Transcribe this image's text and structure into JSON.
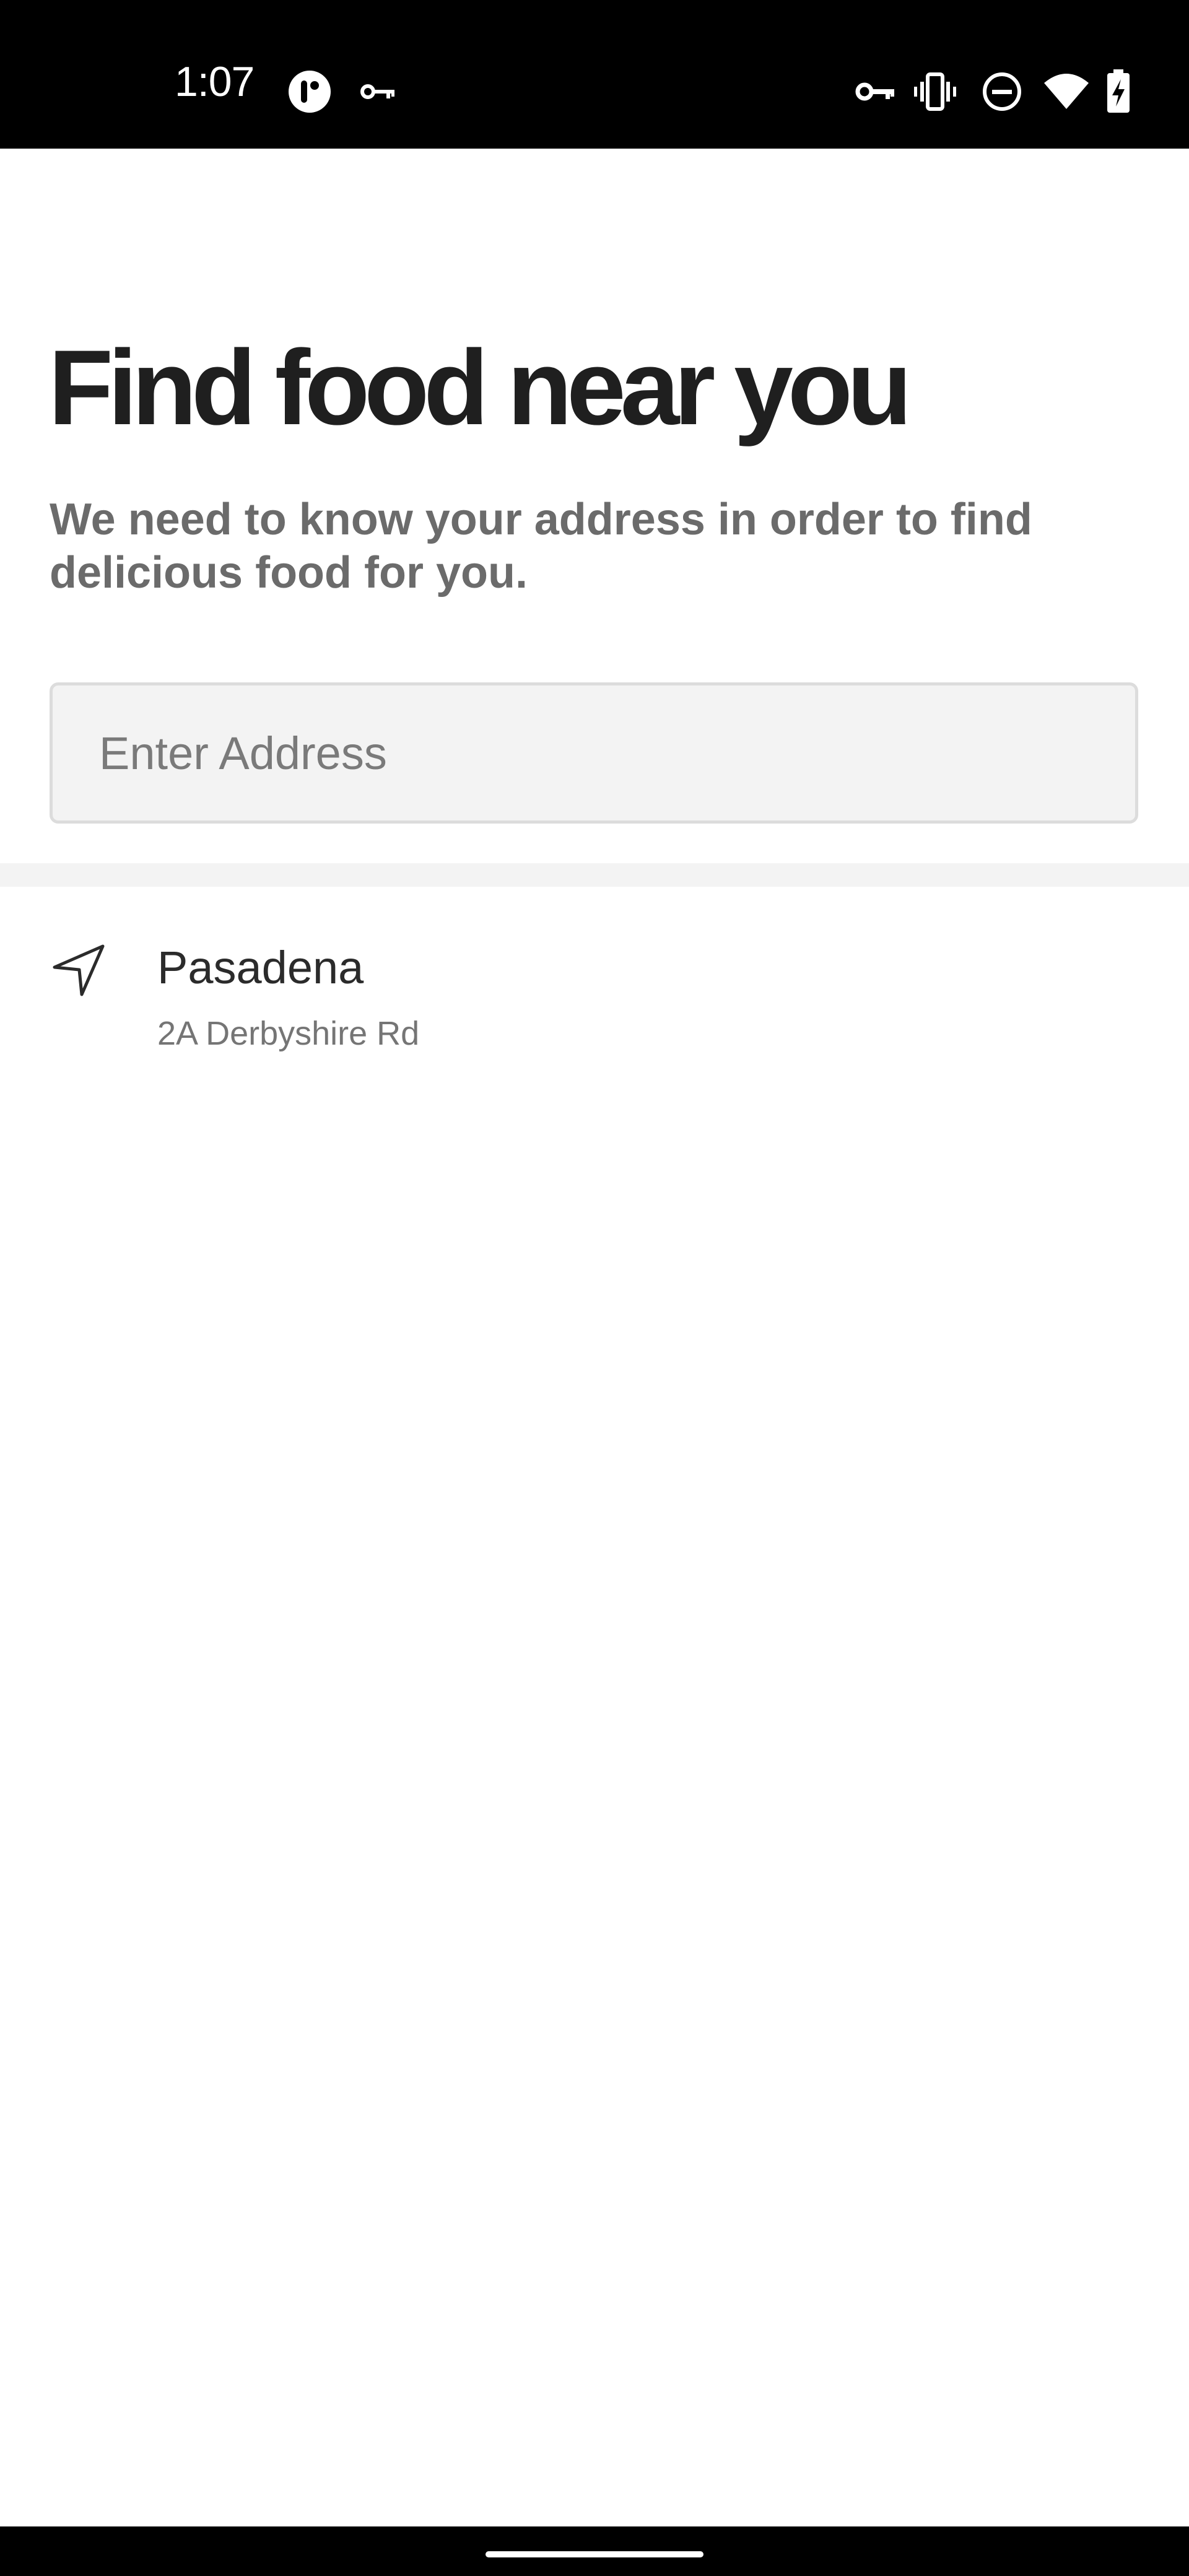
{
  "status_bar": {
    "time": "1:07",
    "icons_left": [
      "pocket-casts-icon",
      "vpn-key-icon"
    ],
    "icons_right": [
      "vpn-key-icon",
      "vibrate-icon",
      "do-not-disturb-icon",
      "wifi-icon",
      "battery-charging-icon"
    ]
  },
  "header": {
    "title": "Find food near you",
    "subtitle": "We need to know your address in order to find delicious food for you."
  },
  "address_input": {
    "placeholder": "Enter Address",
    "value": ""
  },
  "suggestions": [
    {
      "icon": "navigation-arrow-icon",
      "name": "Pasadena",
      "address": "2A Derbyshire Rd"
    }
  ],
  "colors": {
    "title": "#1f1f1f",
    "subtitle": "#6b6b6b",
    "input_background": "#f3f3f3",
    "input_border": "#dcdcdc",
    "status_bar": "#000000"
  }
}
